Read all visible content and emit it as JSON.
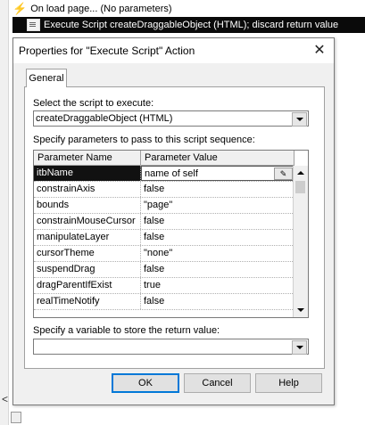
{
  "editor": {
    "onload_text": "On load page... (No parameters)",
    "action_text": "Execute Script createDraggableObject (HTML); discard return value",
    "side_arrow": "<"
  },
  "dialog": {
    "title": "Properties for \"Execute Script\" Action",
    "tab": "General",
    "script_label": "Select the script to execute:",
    "script_value": "createDraggableObject (HTML)",
    "params_label": "Specify parameters to pass to this script sequence:",
    "columns": [
      "Parameter Name",
      "Parameter Value"
    ],
    "rows": [
      {
        "name": "itbName",
        "value": "name of self"
      },
      {
        "name": "constrainAxis",
        "value": "false"
      },
      {
        "name": "bounds",
        "value": "\"page\""
      },
      {
        "name": "constrainMouseCursor",
        "value": "false"
      },
      {
        "name": "manipulateLayer",
        "value": "false"
      },
      {
        "name": "cursorTheme",
        "value": "\"none\""
      },
      {
        "name": "suspendDrag",
        "value": "false"
      },
      {
        "name": "dragParentIfExist",
        "value": "true"
      },
      {
        "name": "realTimeNotify",
        "value": "false"
      }
    ],
    "return_label": "Specify a variable to store the return value:",
    "return_value": "",
    "buttons": {
      "ok": "OK",
      "cancel": "Cancel",
      "help": "Help"
    }
  },
  "colors": {
    "selection": "#111111",
    "default_button_border": "#0078d7",
    "bolt": "#e8a400"
  }
}
